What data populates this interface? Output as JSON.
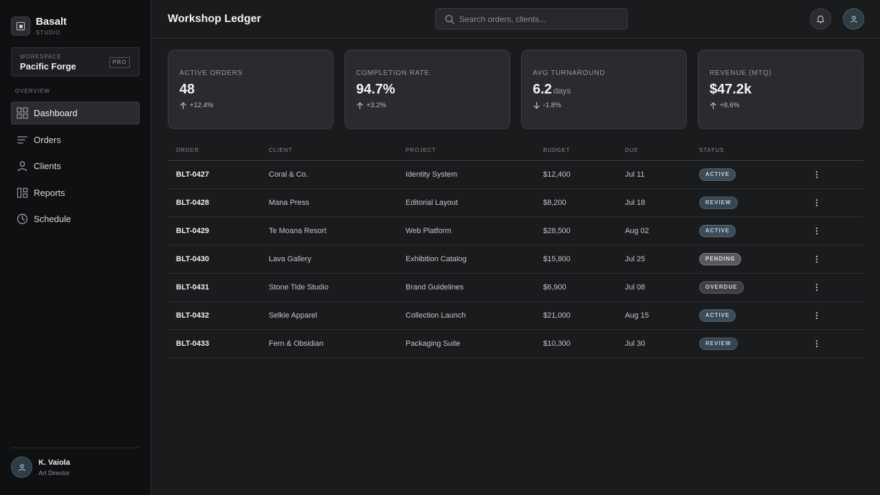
{
  "app": {
    "name": "Basalt",
    "subtitle": "STUDIO"
  },
  "workspace": {
    "label": "WORKSPACE",
    "name": "Pacific Forge",
    "badge": "PRO"
  },
  "nav": {
    "section": "OVERVIEW",
    "items": [
      {
        "label": "Dashboard",
        "icon": "grid-icon",
        "active": true
      },
      {
        "label": "Orders",
        "icon": "list-icon",
        "active": false
      },
      {
        "label": "Clients",
        "icon": "person-icon",
        "active": false
      },
      {
        "label": "Reports",
        "icon": "reports-icon",
        "active": false
      },
      {
        "label": "Schedule",
        "icon": "clock-icon",
        "active": false
      }
    ]
  },
  "user": {
    "name": "K. Vaiola",
    "role": "Art Director"
  },
  "header": {
    "title": "Workshop Ledger"
  },
  "search": {
    "placeholder": "Search orders, clients..."
  },
  "stats": [
    {
      "label": "ACTIVE ORDERS",
      "value": "48",
      "unit": "",
      "delta": "+12.4%",
      "direction": "up"
    },
    {
      "label": "COMPLETION RATE",
      "value": "94.7%",
      "unit": "",
      "delta": "+3.2%",
      "direction": "up"
    },
    {
      "label": "AVG TURNAROUND",
      "value": "6.2",
      "unit": "days",
      "delta": "-1.8%",
      "direction": "down"
    },
    {
      "label": "REVENUE (MTQ)",
      "value": "$47.2k",
      "unit": "",
      "delta": "+8.6%",
      "direction": "up"
    }
  ],
  "table": {
    "columns": [
      "ORDER",
      "CLIENT",
      "PROJECT",
      "BUDGET",
      "DUE",
      "STATUS"
    ],
    "rows": [
      {
        "order": "BLT-0427",
        "client": "Coral & Co.",
        "project": "Identity System",
        "budget": "$12,400",
        "due": "Jul 11",
        "status": "ACTIVE"
      },
      {
        "order": "BLT-0428",
        "client": "Mana Press",
        "project": "Editorial Layout",
        "budget": "$8,200",
        "due": "Jul 18",
        "status": "REVIEW"
      },
      {
        "order": "BLT-0429",
        "client": "Te Moana Resort",
        "project": "Web Platform",
        "budget": "$28,500",
        "due": "Aug 02",
        "status": "ACTIVE"
      },
      {
        "order": "BLT-0430",
        "client": "Lava Gallery",
        "project": "Exhibition Catalog",
        "budget": "$15,800",
        "due": "Jul 25",
        "status": "PENDING"
      },
      {
        "order": "BLT-0431",
        "client": "Stone Tide Studio",
        "project": "Brand Guidelines",
        "budget": "$6,900",
        "due": "Jul 08",
        "status": "OVERDUE"
      },
      {
        "order": "BLT-0432",
        "client": "Selkie Apparel",
        "project": "Collection Launch",
        "budget": "$21,000",
        "due": "Aug 15",
        "status": "ACTIVE"
      },
      {
        "order": "BLT-0433",
        "client": "Fern & Obsidian",
        "project": "Packaging Suite",
        "budget": "$10,300",
        "due": "Jul 30",
        "status": "REVIEW"
      }
    ]
  }
}
